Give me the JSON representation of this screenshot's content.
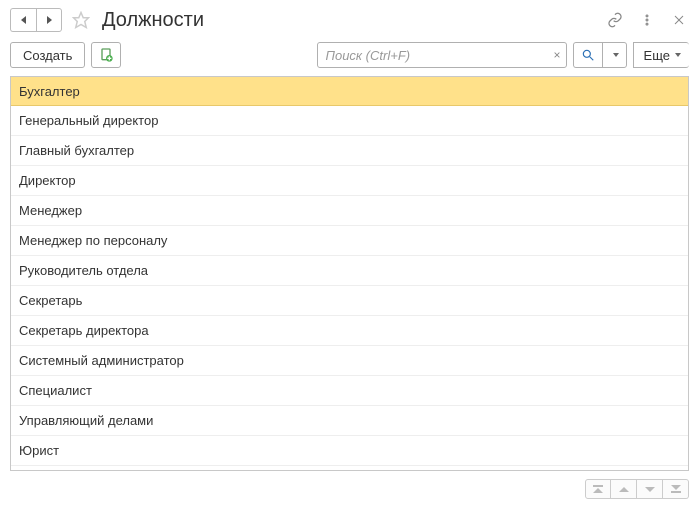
{
  "header": {
    "title": "Должности"
  },
  "toolbar": {
    "create_label": "Создать",
    "search_placeholder": "Поиск (Ctrl+F)",
    "more_label": "Еще"
  },
  "list": {
    "items": [
      {
        "label": "Бухгалтер",
        "selected": true
      },
      {
        "label": "Генеральный директор",
        "selected": false
      },
      {
        "label": "Главный бухгалтер",
        "selected": false
      },
      {
        "label": "Директор",
        "selected": false
      },
      {
        "label": "Менеджер",
        "selected": false
      },
      {
        "label": "Менеджер по персоналу",
        "selected": false
      },
      {
        "label": "Руководитель отдела",
        "selected": false
      },
      {
        "label": "Секретарь",
        "selected": false
      },
      {
        "label": "Секретарь директора",
        "selected": false
      },
      {
        "label": "Системный администратор",
        "selected": false
      },
      {
        "label": "Специалист",
        "selected": false
      },
      {
        "label": "Управляющий делами",
        "selected": false
      },
      {
        "label": "Юрист",
        "selected": false
      }
    ]
  }
}
